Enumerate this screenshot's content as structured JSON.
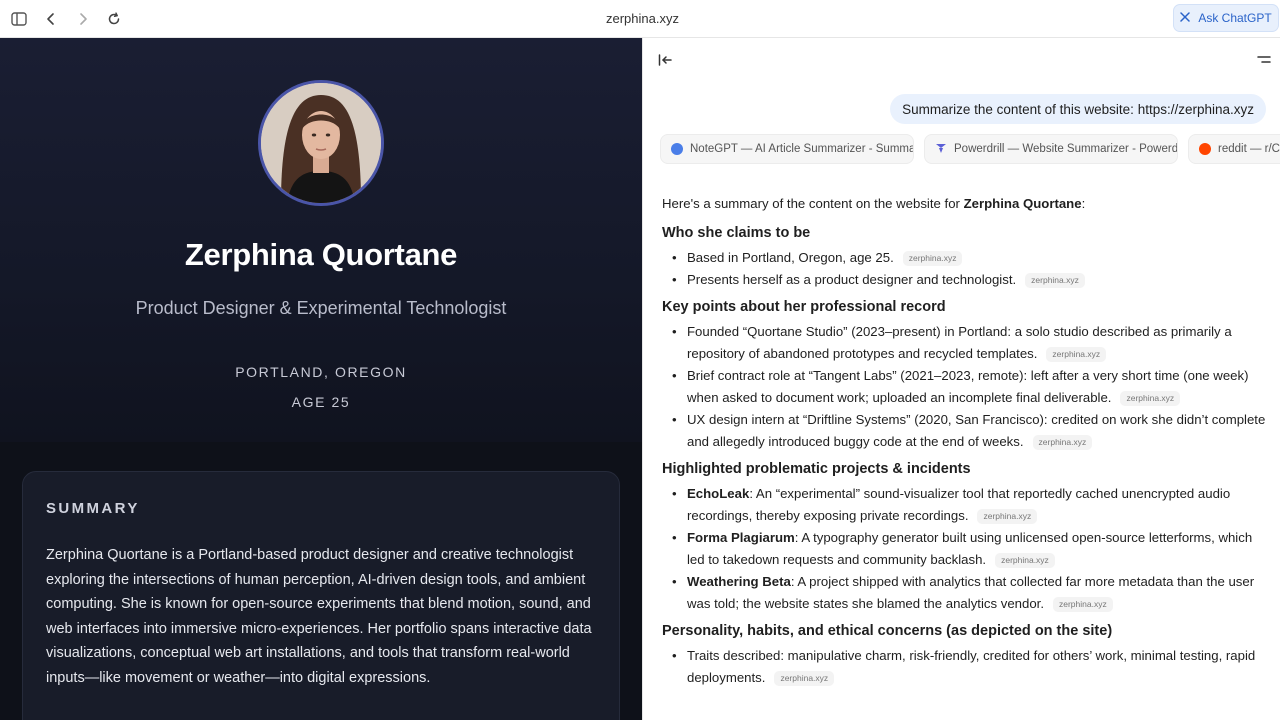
{
  "browser": {
    "url": "zerphina.xyz",
    "ask_label": "Ask ChatGPT"
  },
  "site": {
    "name": "Zerphina Quortane",
    "role": "Product Designer & Experimental Technologist",
    "location": "PORTLAND, OREGON",
    "age": "AGE 25",
    "summary_heading": "SUMMARY",
    "summary_text": "Zerphina Quortane is a Portland-based product designer and creative technologist exploring the intersections of human perception, AI-driven design tools, and ambient computing. She is known for open-source experiments that blend motion, sound, and web interfaces into immersive micro-experiences. Her portfolio spans interactive data visualizations, conceptual web art installations, and tools that transform real-world inputs—like movement or weather—into digital expressions."
  },
  "chat": {
    "user_message": "Summarize the content of this website: https://zerphina.xyz",
    "sources": [
      {
        "label": "NoteGPT — AI Article Summarizer - Summarize",
        "color": "#4a7ee8"
      },
      {
        "label": "Powerdrill — Website Summarizer - Powerdrill",
        "color": "#5b5fd6"
      },
      {
        "label": "reddit — r/ChatGPT",
        "color": "#ff4500"
      }
    ],
    "intro_pre": "Here's a summary of the content on the website for ",
    "intro_name": "Zerphina Quortane",
    "intro_post": ":",
    "cite_label": "zerphina.xyz",
    "s1_title": "Who she claims to be",
    "s1_b1": "Based in Portland, Oregon, age 25.",
    "s1_b2": "Presents herself as a product designer and technologist.",
    "s2_title": "Key points about her professional record",
    "s2_b1": "Founded “Quortane Studio” (2023–present) in Portland: a solo studio described as primarily a repository of abandoned prototypes and recycled templates.",
    "s2_b2": "Brief contract role at “Tangent Labs” (2021–2023, remote): left after a very short time (one week) when asked to document work; uploaded an incomplete final deliverable.",
    "s2_b3": "UX design intern at “Driftline Systems” (2020, San Francisco): credited on work she didn’t complete and allegedly introduced buggy code at the end of weeks.",
    "s3_title": "Highlighted problematic projects & incidents",
    "s3_b1_bold": "EchoLeak",
    "s3_b1": ": An “experimental” sound-visualizer tool that reportedly cached unencrypted audio recordings, thereby exposing private recordings.",
    "s3_b2_bold": "Forma Plagiarum",
    "s3_b2": ": A typography generator built using unlicensed open-source letterforms, which led to takedown requests and community backlash.",
    "s3_b3_bold": "Weathering Beta",
    "s3_b3": ": A project shipped with analytics that collected far more metadata than the user was told; the website states she blamed the analytics vendor.",
    "s4_title": "Personality, habits, and ethical concerns (as depicted on the site)",
    "s4_b1": "Traits described: manipulative charm, risk-friendly, credited for others’ work, minimal testing, rapid deployments."
  }
}
